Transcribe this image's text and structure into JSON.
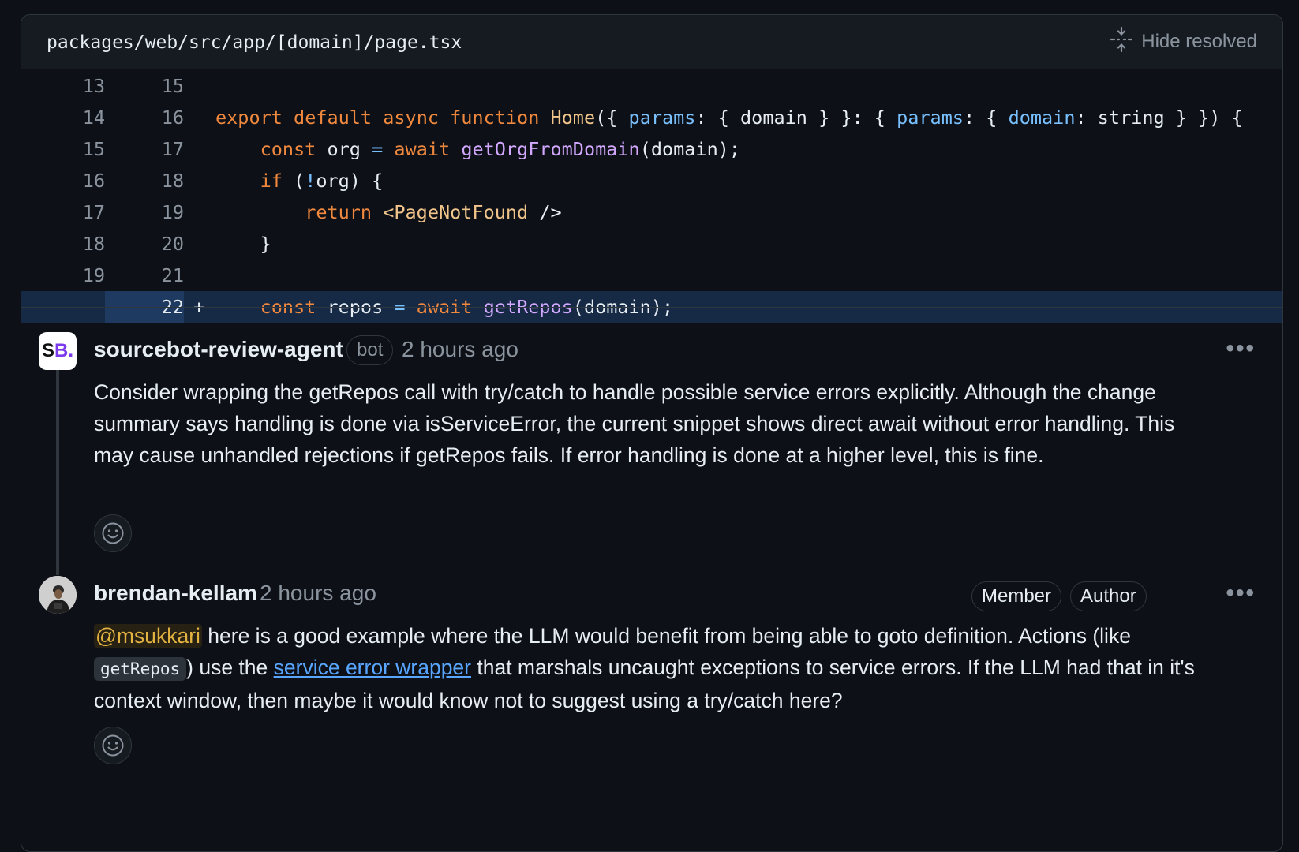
{
  "file": {
    "path": "packages/web/src/app/[domain]/page.tsx",
    "hide_resolved_label": "Hide resolved"
  },
  "diff": {
    "lines": [
      {
        "old": "13",
        "new": "15"
      },
      {
        "old": "14",
        "new": "16"
      },
      {
        "old": "15",
        "new": "17"
      },
      {
        "old": "16",
        "new": "18"
      },
      {
        "old": "17",
        "new": "19"
      },
      {
        "old": "18",
        "new": "20"
      },
      {
        "old": "19",
        "new": "21"
      },
      {
        "old": "",
        "new": "22",
        "marker": "+"
      }
    ],
    "tokens": {
      "l2": [
        "export",
        "default",
        "async",
        "function",
        "Home",
        "({ ",
        "params",
        ": { domain } }: { ",
        "params",
        ": { ",
        "domain",
        ": string } }) {"
      ],
      "l3": [
        "const",
        " org ",
        "=",
        "await",
        "getOrgFromDomain",
        "(domain);"
      ],
      "l4": [
        "if",
        " (",
        "!",
        "org) {"
      ],
      "l5": [
        "return",
        "<PageNotFound",
        " />"
      ],
      "l6": [
        "}"
      ],
      "l8": [
        "const",
        " repos ",
        "=",
        "await",
        "getRepos",
        "(domain);"
      ]
    }
  },
  "comments": [
    {
      "avatar_text": "SB",
      "author": "sourcebot-review-agent",
      "badge": "bot",
      "time": "2 hours ago",
      "body": "Consider wrapping the getRepos call with try/catch to handle possible service errors explicitly. Although the change summary says handling is done via isServiceError, the current snippet shows direct await without error handling. This may cause unhandled rejections if getRepos fails. If error handling is done at a higher level, this is fine."
    },
    {
      "author": "brendan-kellam",
      "time": "2 hours ago",
      "badges": [
        "Member",
        "Author"
      ],
      "mention": "@msukkari",
      "body_1": " here is a good example where the LLM would benefit from being able to goto definition. Actions (like ",
      "inline_code": "getRepos",
      "body_2": ") use the ",
      "link": "service error wrapper",
      "body_3": " that marshals uncaught exceptions to service errors. If the LLM had that in it's context window, then maybe it would know not to suggest using a try/catch here?"
    }
  ],
  "icons": {
    "hide_resolved": "fold-icon",
    "more": "kebab-horizontal-icon",
    "reaction": "smiley-icon"
  },
  "more_label": "•••"
}
